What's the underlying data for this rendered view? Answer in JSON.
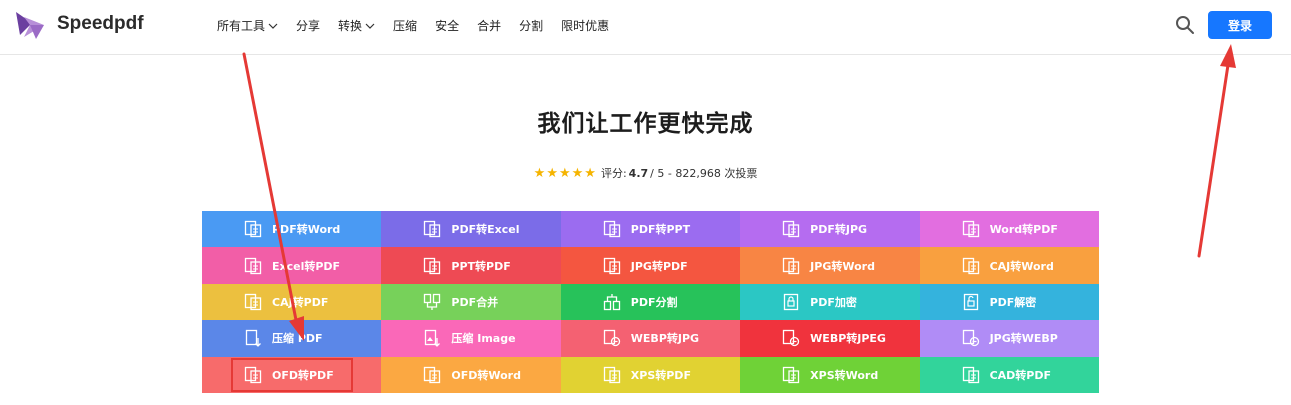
{
  "header": {
    "brand": "Speedpdf",
    "nav": [
      {
        "label": "所有工具",
        "dropdown": true
      },
      {
        "label": "分享",
        "dropdown": false
      },
      {
        "label": "转换",
        "dropdown": true
      },
      {
        "label": "压缩",
        "dropdown": false
      },
      {
        "label": "安全",
        "dropdown": false
      },
      {
        "label": "合并",
        "dropdown": false
      },
      {
        "label": "分割",
        "dropdown": false
      },
      {
        "label": "限时优惠",
        "dropdown": false
      }
    ],
    "login_label": "登录",
    "more_glyph": "⋮"
  },
  "hero": {
    "title": "我们让工作更快完成",
    "rating_label": "评分:",
    "rating_value": "4.7",
    "rating_rest": "/ 5 - 822,968 次投票",
    "stars": "★★★★★"
  },
  "tools": [
    {
      "label": "PDF转Word",
      "color": "#4a9af3"
    },
    {
      "label": "PDF转Excel",
      "color": "#7b6ce8"
    },
    {
      "label": "PDF转PPT",
      "color": "#9b6cf0"
    },
    {
      "label": "PDF转JPG",
      "color": "#b56cf0"
    },
    {
      "label": "Word转PDF",
      "color": "#e26ee0"
    },
    {
      "label": "Excel转PDF",
      "color": "#f25ea7"
    },
    {
      "label": "PPT转PDF",
      "color": "#ee4a54"
    },
    {
      "label": "JPG转PDF",
      "color": "#f45640"
    },
    {
      "label": "JPG转Word",
      "color": "#f88544"
    },
    {
      "label": "CAJ转Word",
      "color": "#f9a03f"
    },
    {
      "label": "CAJ转PDF",
      "color": "#ecc03f"
    },
    {
      "label": "PDF合并",
      "color": "#77d15a"
    },
    {
      "label": "PDF分割",
      "color": "#27c25a"
    },
    {
      "label": "PDF加密",
      "color": "#2bc7c4"
    },
    {
      "label": "PDF解密",
      "color": "#34b3dd"
    },
    {
      "label": "压缩 PDF",
      "color": "#5b87e8"
    },
    {
      "label": "压缩 Image",
      "color": "#fa68b8"
    },
    {
      "label": "WEBP转JPG",
      "color": "#f46172"
    },
    {
      "label": "WEBP转JPEG",
      "color": "#f0333d"
    },
    {
      "label": "JPG转WEBP",
      "color": "#b08cf6"
    },
    {
      "label": "OFD转PDF",
      "color": "#f76b6b"
    },
    {
      "label": "OFD转Word",
      "color": "#fba842"
    },
    {
      "label": "XPS转PDF",
      "color": "#e1d232"
    },
    {
      "label": "XPS转Word",
      "color": "#6fd237"
    },
    {
      "label": "CAD转PDF",
      "color": "#32d49b"
    }
  ],
  "accent": "#1677ff",
  "annotation_color": "#e53935"
}
